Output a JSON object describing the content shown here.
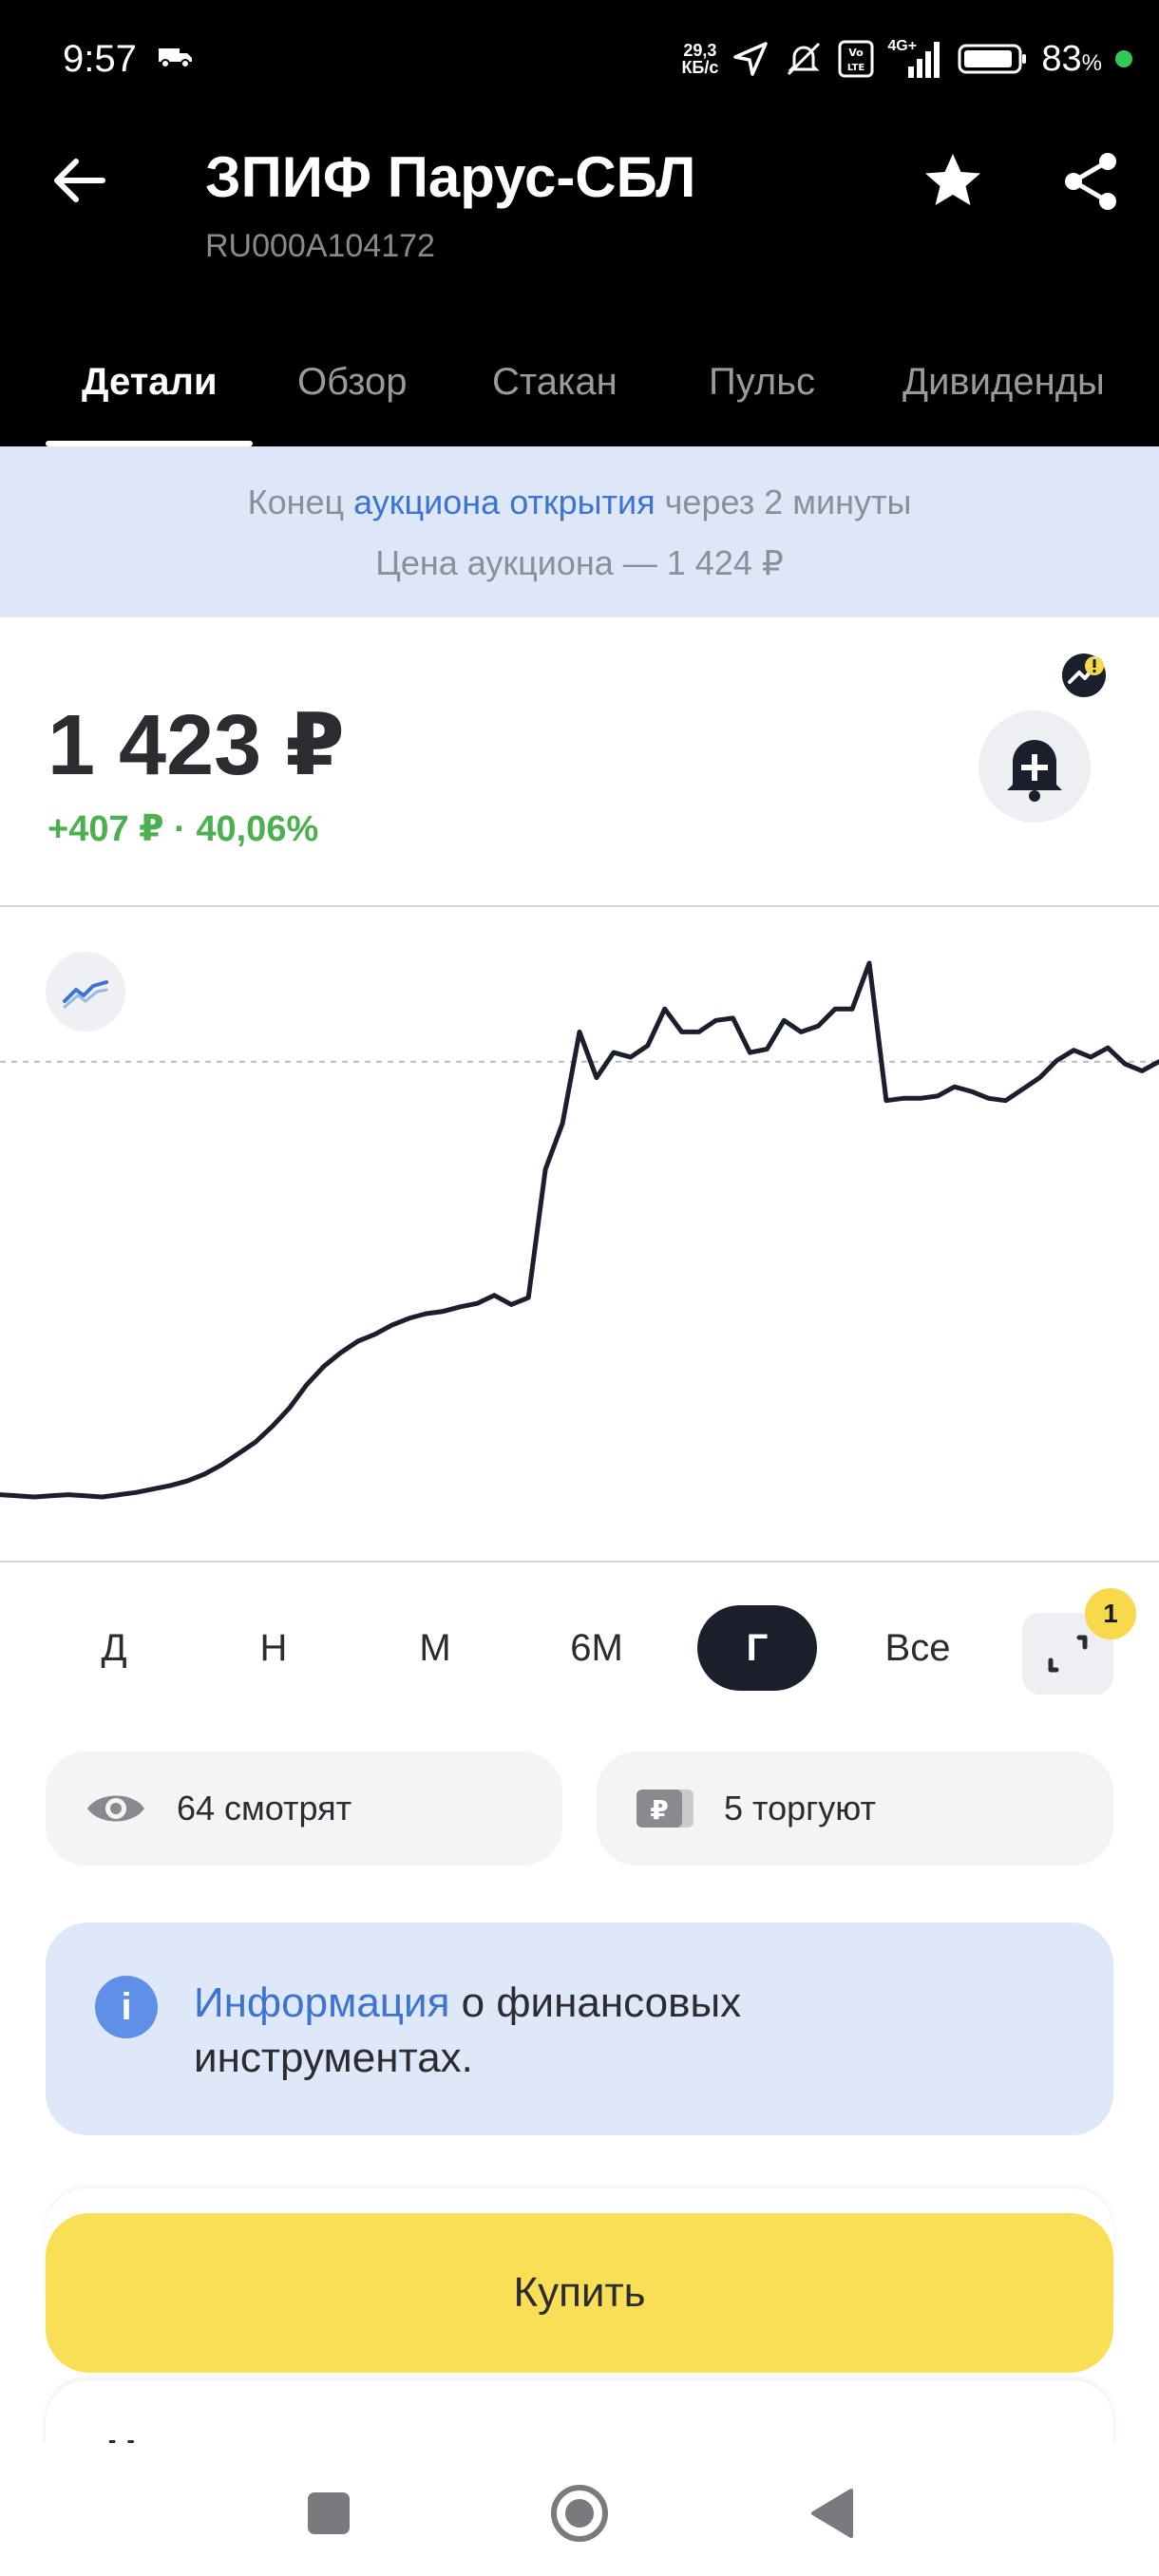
{
  "status_bar": {
    "time": "9:57",
    "net_speed_value": "29,3",
    "net_speed_unit": "КБ/с",
    "signal": "4G+",
    "battery": "83",
    "battery_unit": "%"
  },
  "header": {
    "title": "ЗПИФ Парус-СБЛ",
    "isin": "RU000A104172"
  },
  "tabs": [
    {
      "label": "Детали",
      "active": true
    },
    {
      "label": "Обзор",
      "active": false
    },
    {
      "label": "Стакан",
      "active": false
    },
    {
      "label": "Пульс",
      "active": false
    },
    {
      "label": "Дивиденды",
      "active": false
    }
  ],
  "auction": {
    "prefix": "Конец",
    "link": "аукциона открытия",
    "suffix": "через 2 минуты",
    "price_line": "Цена аукциона — 1 424 ₽"
  },
  "quote": {
    "price": "1 423 ₽",
    "change": "+407 ₽ · 40,06%"
  },
  "chart_data": {
    "type": "line",
    "title": "",
    "xlabel": "",
    "ylabel": "",
    "period": "Г",
    "grid": false,
    "reference_line": "dashed horizontal at current price level",
    "series": [
      {
        "values": [
          1016,
          1015,
          1014,
          1015,
          1016,
          1015,
          1014,
          1016,
          1018,
          1021,
          1024,
          1028,
          1034,
          1042,
          1052,
          1062,
          1076,
          1092,
          1112,
          1128,
          1140,
          1150,
          1156,
          1164,
          1170,
          1174,
          1176,
          1180,
          1183,
          1190,
          1182,
          1188,
          1300,
          1340,
          1420,
          1380,
          1402,
          1398,
          1408,
          1440,
          1420,
          1420,
          1430,
          1432,
          1402,
          1405,
          1430,
          1420,
          1425,
          1440,
          1440,
          1480,
          1360,
          1362,
          1362,
          1364,
          1372,
          1368,
          1362,
          1360,
          1370,
          1380,
          1395,
          1404,
          1398,
          1406,
          1392,
          1386,
          1394
        ]
      }
    ],
    "colors": {
      "line": "#1a1f2b",
      "reference": "#b9b9be"
    }
  },
  "periods": [
    {
      "label": "Д",
      "active": false
    },
    {
      "label": "Н",
      "active": false
    },
    {
      "label": "М",
      "active": false
    },
    {
      "label": "6М",
      "active": false
    },
    {
      "label": "Г",
      "active": true
    },
    {
      "label": "Все",
      "active": false
    }
  ],
  "expand_badge": "1",
  "stats": {
    "watching": "64 смотрят",
    "trading": "5 торгуют"
  },
  "info": {
    "link": "Информация",
    "text": "о финансовых инструментах."
  },
  "buy_label": "Купить",
  "peek_label": "Н",
  "icons": {
    "back": "arrow-left-icon",
    "star": "star-icon",
    "share": "share-icon",
    "alert": "bell-plus-icon",
    "chart_type": "line-chart-icon",
    "expand": "expand-icon",
    "eye": "eye-icon",
    "ruble": "ruble-card-icon",
    "info": "info-icon"
  },
  "accent": {
    "yellow": "#f9df55",
    "blue": "#3d74d1",
    "green": "#4caf50"
  }
}
